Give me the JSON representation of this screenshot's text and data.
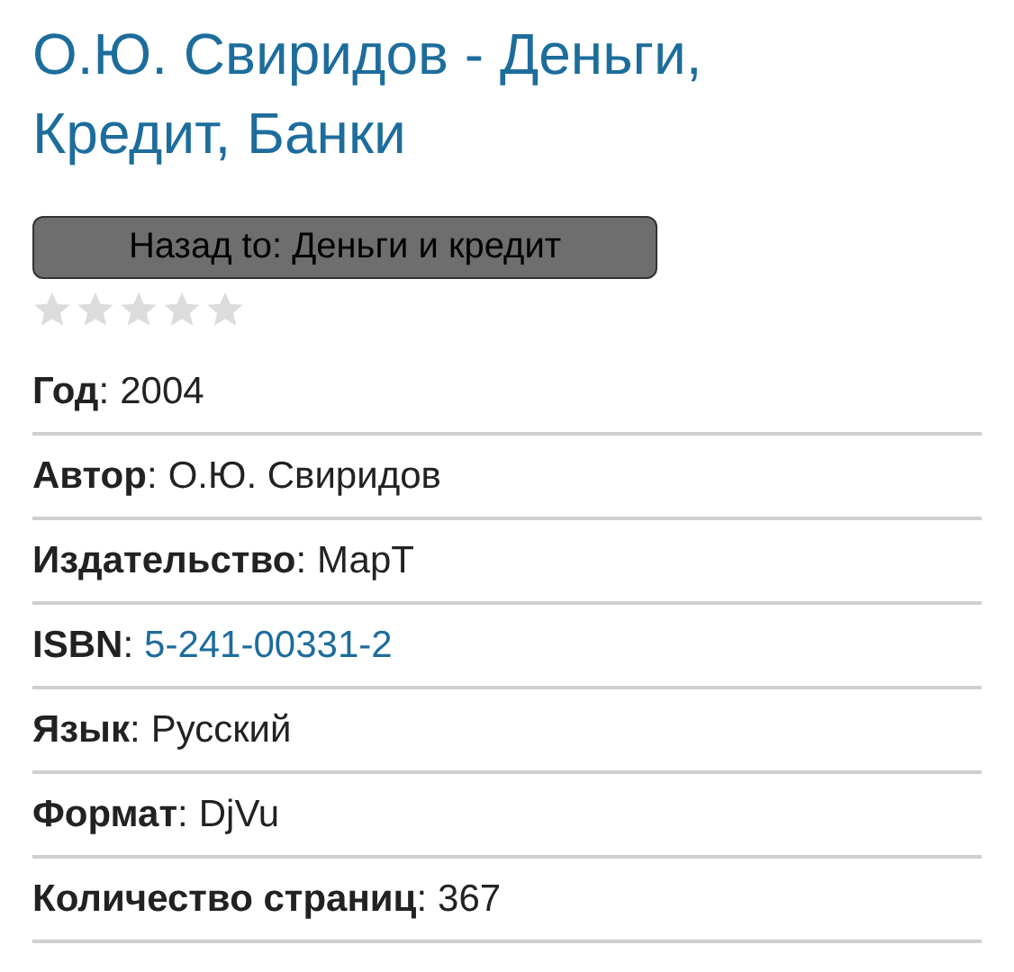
{
  "title": "О.Ю. Свиридов - Деньги, Кредит, Банки",
  "back_button": "Назад to: Деньги и кредит",
  "rating": {
    "stars": 0
  },
  "details": [
    {
      "label": "**Год**:",
      "value": "2004",
      "kind": "text"
    },
    {
      "label": "**Автор**:",
      "value": "О.Ю. Свиридов",
      "kind": "text"
    },
    {
      "label": "**Издательство**:",
      "value": "МарТ",
      "kind": "text"
    },
    {
      "label": "**ISBN**:",
      "value": "5-241-00331-2",
      "kind": "link"
    },
    {
      "label": "**Язык**:",
      "value": "Русский",
      "kind": "text"
    },
    {
      "label": "**Формат**:",
      "value": "DjVu",
      "kind": "text"
    },
    {
      "label": "**Количество страниц**:",
      "value": "367",
      "kind": "text"
    }
  ]
}
